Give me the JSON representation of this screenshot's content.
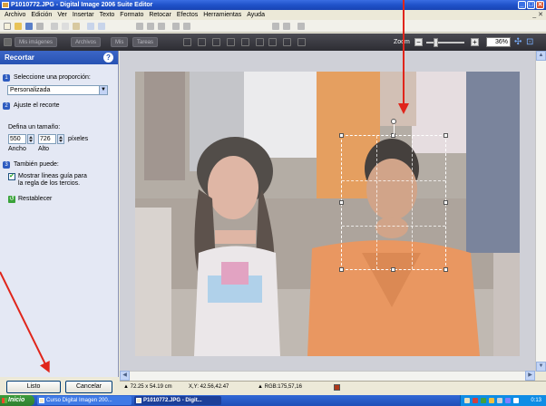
{
  "window": {
    "title": "P1010772.JPG - Digital Image 2006 Suite Editor",
    "controls": [
      "_",
      "□",
      "✕"
    ]
  },
  "menu": {
    "items": [
      "Archivo",
      "Edición",
      "Ver",
      "Insertar",
      "Texto",
      "Formato",
      "Retocar",
      "Efectos",
      "Herramientas",
      "Ayuda"
    ],
    "close_doc": "_ ✕"
  },
  "toolbar2": {
    "buttons": [
      "Mis imágenes",
      "Archivos",
      "Mis",
      "Tareas"
    ],
    "zoom_label": "Zoom",
    "zoom_value": "36%"
  },
  "panel": {
    "title": "Recortar",
    "step1": {
      "num": "1",
      "label": "Seleccione una proporción:"
    },
    "proportion": "Personalizada",
    "step2": {
      "num": "2",
      "label": "Ajuste el recorte"
    },
    "size_label": "Defina un tamaño:",
    "width_value": "550",
    "height_value": "726",
    "unit_label": "píxeles",
    "width_caption": "Ancho",
    "height_caption": "Alto",
    "step3": {
      "num": "3",
      "label": "También puede:"
    },
    "guides_line1": "Mostrar líneas guía para",
    "guides_line2": "la regla de los tercios.",
    "guides_checked": "✔",
    "restore_label": "Restablecer",
    "done_label": "Listo",
    "cancel_label": "Cancelar"
  },
  "status": {
    "dimensions": "72.25 x 54.19 cm",
    "coords": "X,Y: 42.56,42.47",
    "rgb": "RGB:175,57,16",
    "swatch_color": "#af391a"
  },
  "taskbar": {
    "start_label": "Inicio",
    "task1": "Curso Digital Imagen 200...",
    "task2": "P1010772.JPG - Digit...",
    "clock": "0:13"
  },
  "colors": {
    "annotation_arrow": "#e0251b",
    "panel_header": "#2752b3"
  }
}
